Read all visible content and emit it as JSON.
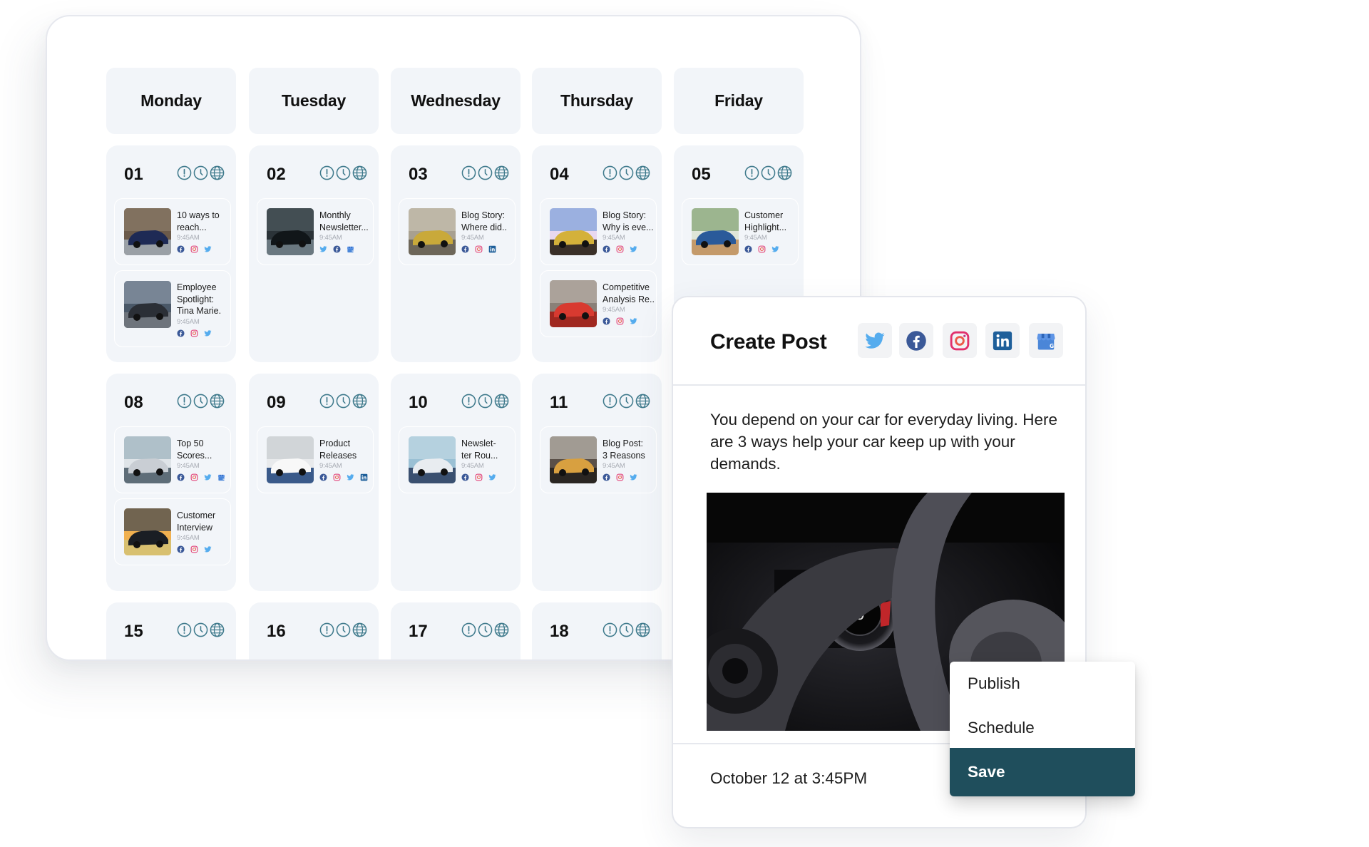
{
  "calendar": {
    "weekdays": [
      "Monday",
      "Tuesday",
      "Wednesday",
      "Thursday",
      "Friday"
    ],
    "status_icons": [
      "alert-icon",
      "clock-icon",
      "globe-icon"
    ],
    "weeks": [
      [
        {
          "day": "01",
          "posts": [
            {
              "title": "10 ways to\nreach...",
              "time": "9:45AM",
              "networks": [
                "facebook",
                "instagram",
                "twitter"
              ],
              "thumb": "car-dark-blue-sedan"
            },
            {
              "title": "Employee\nSpotlight:\nTina Marie.",
              "time": "9:45AM",
              "networks": [
                "facebook",
                "instagram",
                "twitter"
              ],
              "thumb": "car-gray-coupe"
            }
          ]
        },
        {
          "day": "02",
          "posts": [
            {
              "title": "Monthly\nNewsletter...",
              "time": "9:45AM",
              "networks": [
                "twitter",
                "facebook",
                "google-business"
              ],
              "thumb": "car-interior"
            }
          ]
        },
        {
          "day": "03",
          "posts": [
            {
              "title": "Blog Story:\nWhere did..",
              "time": "9:45AM",
              "networks": [
                "facebook",
                "instagram",
                "linkedin"
              ],
              "thumb": "car-yellow-suv"
            }
          ]
        },
        {
          "day": "04",
          "posts": [
            {
              "title": "Blog Story:\nWhy is eve...",
              "time": "9:45AM",
              "networks": [
                "facebook",
                "instagram",
                "twitter"
              ],
              "thumb": "car-yellow-hatch"
            },
            {
              "title": "Competitive\nAnalysis Re..",
              "time": "9:45AM",
              "networks": [
                "facebook",
                "instagram",
                "twitter"
              ],
              "thumb": "car-red"
            }
          ]
        },
        {
          "day": "05",
          "posts": [
            {
              "title": "Customer\nHighlight...",
              "time": "9:45AM",
              "networks": [
                "facebook",
                "instagram",
                "twitter"
              ],
              "thumb": "customer-man-hat"
            }
          ]
        }
      ],
      [
        {
          "day": "08",
          "posts": [
            {
              "title": "Top 50\nScores...",
              "time": "9:45AM",
              "networks": [
                "facebook",
                "instagram",
                "twitter",
                "google-business"
              ],
              "thumb": "car-showroom"
            },
            {
              "title": "Customer\nInterview",
              "time": "9:45AM",
              "networks": [
                "facebook",
                "instagram",
                "twitter"
              ],
              "thumb": "car-wheel-sunset"
            }
          ]
        },
        {
          "day": "09",
          "posts": [
            {
              "title": "Product\nReleases",
              "time": "9:45AM",
              "networks": [
                "facebook",
                "instagram",
                "twitter",
                "linkedin"
              ],
              "thumb": "couple-white-car"
            }
          ]
        },
        {
          "day": "10",
          "posts": [
            {
              "title": "Newslet-\nter Rou...",
              "time": "9:45AM",
              "networks": [
                "facebook",
                "instagram",
                "twitter"
              ],
              "thumb": "car-police-suv"
            }
          ]
        },
        {
          "day": "11",
          "posts": [
            {
              "title": "Blog Post:\n3 Reasons",
              "time": "9:45AM",
              "networks": [
                "facebook",
                "instagram",
                "twitter"
              ],
              "thumb": "woman-keys-car"
            }
          ]
        }
      ],
      [
        {
          "day": "15",
          "posts": []
        },
        {
          "day": "16",
          "posts": []
        },
        {
          "day": "17",
          "posts": []
        },
        {
          "day": "18",
          "posts": []
        }
      ]
    ]
  },
  "create_post": {
    "title": "Create Post",
    "networks": [
      "twitter",
      "facebook",
      "instagram",
      "linkedin",
      "google-business"
    ],
    "body": "You depend on your car for everyday living. Here are 3 ways help your car keep up with your demands.",
    "image": "steering-wheel-dashboard",
    "scheduled": "October 12 at 3:45PM"
  },
  "action_menu": {
    "items": [
      {
        "label": "Publish",
        "active": false
      },
      {
        "label": "Schedule",
        "active": false
      },
      {
        "label": "Save",
        "active": true
      }
    ]
  },
  "colors": {
    "accent": "#1f4e5c",
    "status_icon": "#3f7a8c",
    "cell_bg": "#f2f5f9",
    "twitter": "#55acee",
    "facebook": "#3b5998",
    "linkedin": "#0a66c2",
    "instagram": "#e1306c",
    "google_business": "#4285f4"
  }
}
